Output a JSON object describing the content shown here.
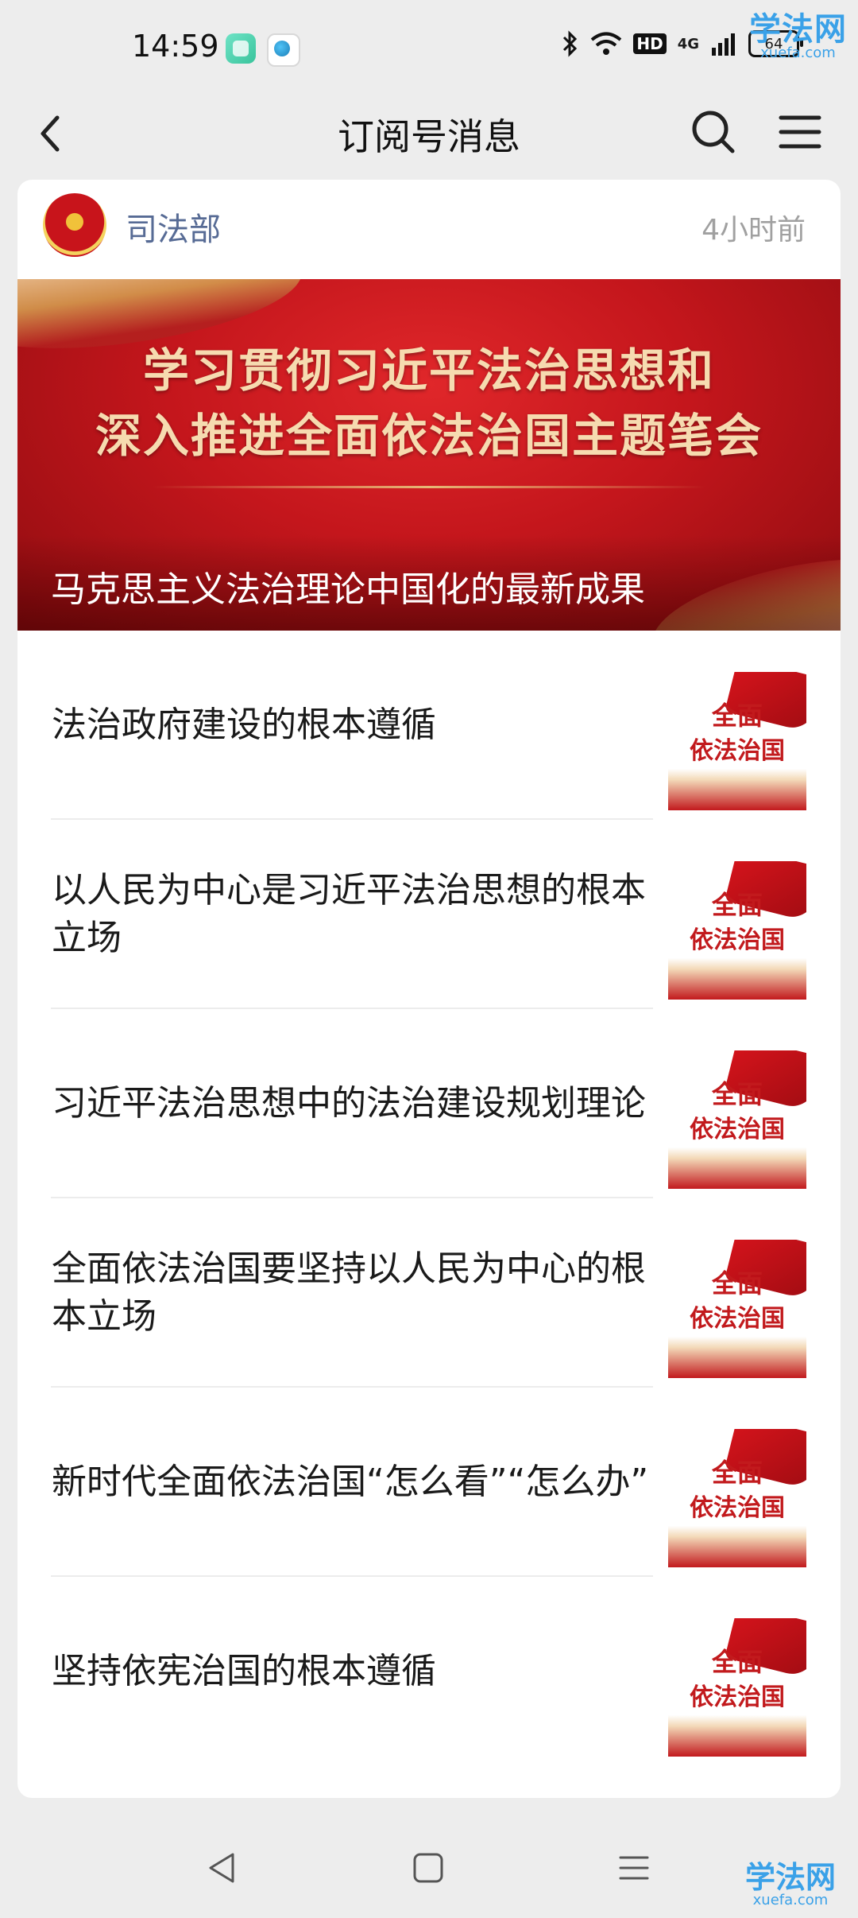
{
  "status_bar": {
    "time": "14:59",
    "network": "4G",
    "hd": "HD",
    "battery": "64"
  },
  "watermark": {
    "cn": "学法网",
    "en": "xuefa.com"
  },
  "nav": {
    "title": "订阅号消息"
  },
  "account": {
    "name": "司法部",
    "time": "4小时前"
  },
  "hero": {
    "line1": "学习贯彻习近平法治思想和",
    "line2": "深入推进全面依法治国主题笔会",
    "caption": "马克思主义法治理论中国化的最新成果"
  },
  "thumb": {
    "l1": "全面",
    "l2": "依法治国"
  },
  "articles": [
    {
      "title": "法治政府建设的根本遵循"
    },
    {
      "title": "以人民为中心是习近平法治思想的根本立场"
    },
    {
      "title": "习近平法治思想中的法治建设规划理论"
    },
    {
      "title": "全面依法治国要坚持以人民为中心的根本立场"
    },
    {
      "title": "新时代全面依法治国“怎么看”“怎么办”"
    },
    {
      "title": "坚持依宪治国的根本遵循"
    }
  ]
}
